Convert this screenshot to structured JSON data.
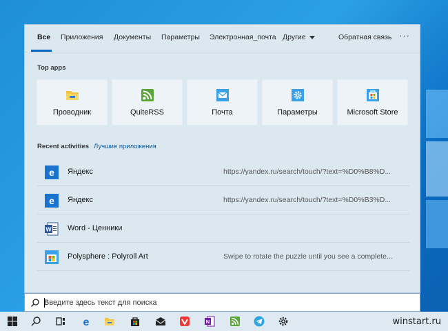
{
  "tabs": [
    {
      "label": "Все",
      "active": true
    },
    {
      "label": "Приложения"
    },
    {
      "label": "Документы"
    },
    {
      "label": "Параметры"
    },
    {
      "label": "Электронная_почта"
    },
    {
      "label": "Другие"
    }
  ],
  "feedback_label": "Обратная связь",
  "more_label": "···",
  "top_apps": {
    "label": "Top apps",
    "items": [
      {
        "label": "Проводник",
        "icon": "folder-icon"
      },
      {
        "label": "QuiteRSS",
        "icon": "rss-icon"
      },
      {
        "label": "Почта",
        "icon": "mail-icon"
      },
      {
        "label": "Параметры",
        "icon": "gear-icon"
      },
      {
        "label": "Microsoft Store",
        "icon": "store-icon"
      }
    ]
  },
  "recent": {
    "label": "Recent activities",
    "best_apps_link": "Лучшие приложения",
    "items": [
      {
        "title": "Яндекс",
        "subtitle": "https://yandex.ru/search/touch/?text=%D0%B8%D...",
        "icon": "edge-icon"
      },
      {
        "title": "Яндекс",
        "subtitle": "https://yandex.ru/search/touch/?text=%D0%B3%D...",
        "icon": "edge-icon"
      },
      {
        "title": "Word - Ценники",
        "subtitle": "",
        "icon": "word-icon"
      },
      {
        "title": "Polysphere : Polyroll Art",
        "subtitle": "Swipe to rotate the puzzle until you see a complete...",
        "icon": "store-icon"
      }
    ]
  },
  "search": {
    "placeholder": "Введите здесь текст для поиска",
    "value": ""
  },
  "taskbar": {
    "items": [
      "windows-start-icon",
      "search-icon",
      "task-view-icon",
      "edge-icon",
      "explorer-icon",
      "store-icon",
      "mail-icon",
      "vivaldi-icon",
      "onenote-icon",
      "quiterss-icon",
      "telegram-icon",
      "settings-icon"
    ]
  },
  "watermark": "winstart.ru",
  "colors": {
    "accent": "#0067c0",
    "panel_bg": "#dce8f0"
  }
}
